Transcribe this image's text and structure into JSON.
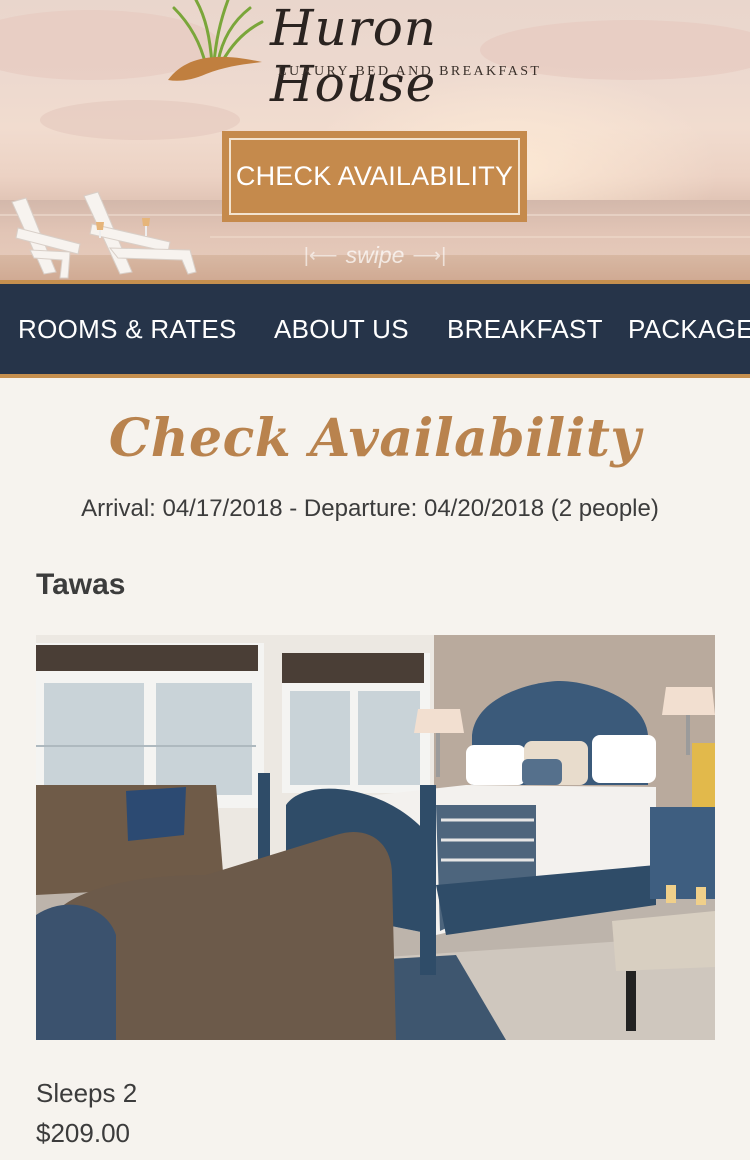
{
  "brand": {
    "name": "Huron House",
    "tagline": "LUXURY BED AND BREAKFAST"
  },
  "hero": {
    "cta_label": "CHECK AVAILABILITY",
    "swipe_hint": "swipe"
  },
  "nav": {
    "items": [
      {
        "label": "ROOMS & RATES"
      },
      {
        "label": "ABOUT US"
      },
      {
        "label": "BREAKFAST"
      },
      {
        "label": "PACKAGE"
      }
    ]
  },
  "availability": {
    "title": "Check Availability",
    "summary": "Arrival: 04/17/2018 - Departure: 04/20/2018 (2 people)"
  },
  "room": {
    "name": "Tawas",
    "sleeps": "Sleeps 2",
    "price": "$209.00"
  },
  "colors": {
    "accent": "#c58a4c",
    "nav_bg": "#263449",
    "script": "#b9834e",
    "text": "#3c3c3c"
  },
  "icons": {
    "logo": "dune-grass-logo-icon",
    "swipe_left": "arrow-left-icon",
    "swipe_right": "arrow-right-icon"
  }
}
